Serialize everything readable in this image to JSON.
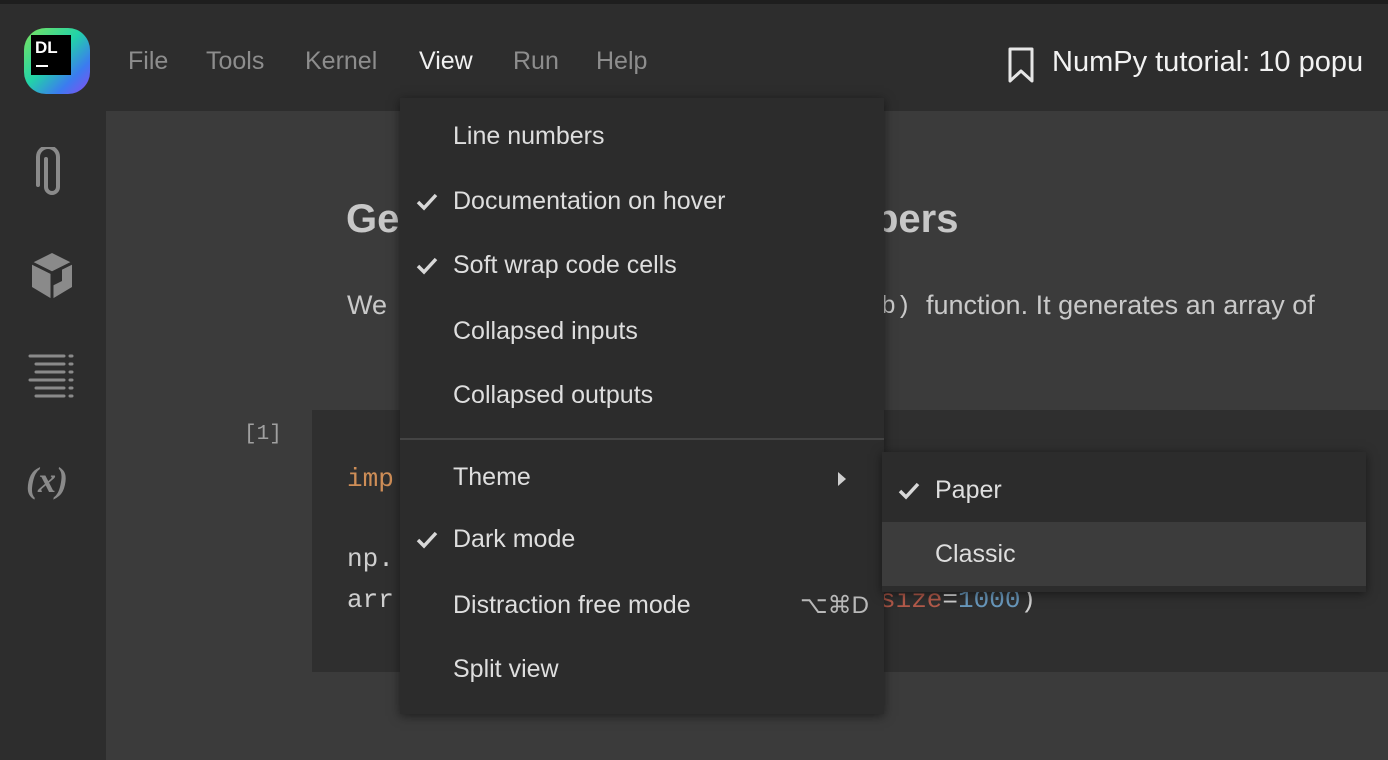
{
  "app": {
    "logo_text": "DL",
    "document_title": "NumPy tutorial: 10 popu"
  },
  "menubar": {
    "items": [
      {
        "label": "File"
      },
      {
        "label": "Tools"
      },
      {
        "label": "Kernel"
      },
      {
        "label": "View"
      },
      {
        "label": "Run"
      },
      {
        "label": "Help"
      }
    ]
  },
  "sidebar": {
    "icons": [
      "paperclip-icon",
      "package-icon",
      "outline-icon",
      "variables-icon"
    ],
    "variables_glyph": "(x)"
  },
  "notebook": {
    "heading_start": "Ge",
    "heading_end": "bers",
    "para_start": "We",
    "para_code": "b)",
    "para_rest": "function. It generates an array of",
    "cell_number": "[1]",
    "code_line1": "imp",
    "code_line2": "np.",
    "code_line3_start": "arr",
    "code_param": "size",
    "code_eq": "=",
    "code_num": "1000",
    "code_close": ")"
  },
  "view_menu": {
    "items": [
      {
        "label": "Line numbers",
        "checked": false
      },
      {
        "label": "Documentation on hover",
        "checked": true
      },
      {
        "label": "Soft wrap code cells",
        "checked": true
      },
      {
        "label": "Collapsed inputs",
        "checked": false
      },
      {
        "label": "Collapsed outputs",
        "checked": false
      },
      {
        "label": "Theme",
        "checked": false,
        "submenu": true
      },
      {
        "label": "Dark mode",
        "checked": true
      },
      {
        "label": "Distraction free mode",
        "checked": false,
        "shortcut": "⌥⌘D"
      },
      {
        "label": "Split view",
        "checked": false
      }
    ]
  },
  "theme_submenu": {
    "items": [
      {
        "label": "Paper",
        "checked": true
      },
      {
        "label": "Classic",
        "checked": false,
        "hovered": true
      }
    ]
  },
  "colors": {
    "accent_keyword": "#cf8e57",
    "param": "#b25a4a",
    "number": "#6897bb"
  }
}
